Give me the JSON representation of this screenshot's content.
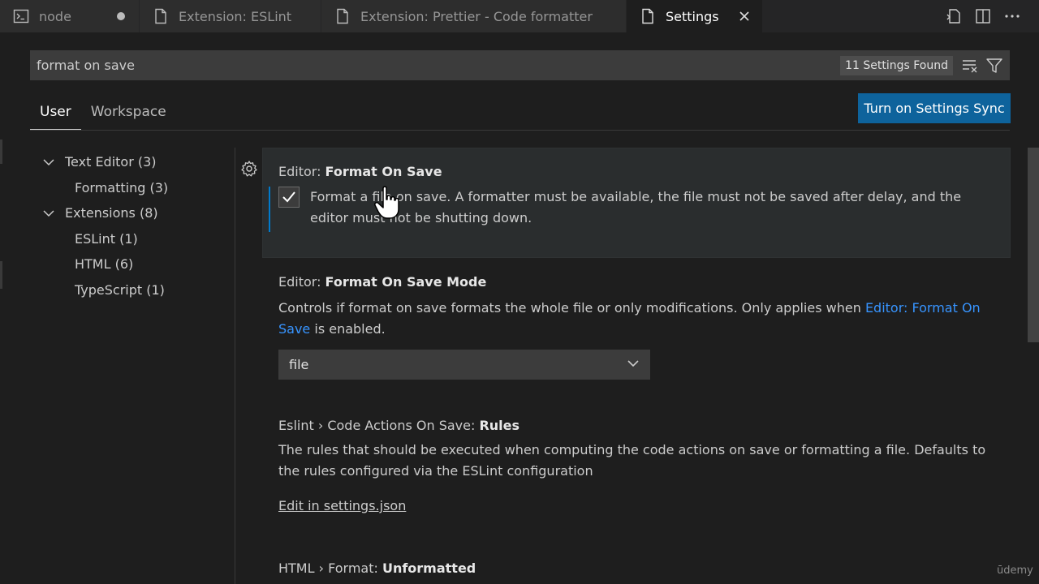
{
  "tabs": [
    {
      "label": "node",
      "icon": "terminal-icon",
      "indicator": "dirty-dot"
    },
    {
      "label": "Extension: ESLint",
      "icon": "file-icon"
    },
    {
      "label": "Extension: Prettier - Code formatter",
      "icon": "file-icon"
    },
    {
      "label": "Settings",
      "icon": "file-icon",
      "active": true,
      "indicator": "close-icon"
    }
  ],
  "tab_actions": [
    "open-settings-json-icon",
    "split-editor-icon",
    "more-actions-icon"
  ],
  "search": {
    "value": "format on save",
    "found_label": "11 Settings Found"
  },
  "scope_tabs": {
    "user": "User",
    "workspace": "Workspace"
  },
  "sync_button": "Turn on Settings Sync",
  "toc": [
    {
      "label": "Text Editor (3)",
      "expanded": true
    },
    {
      "label": "Formatting (3)"
    },
    {
      "label": "Extensions (8)",
      "expanded": true
    },
    {
      "label": "ESLint (1)"
    },
    {
      "label": "HTML (6)"
    },
    {
      "label": "TypeScript (1)"
    }
  ],
  "settings": {
    "format_on_save": {
      "category": "Editor: ",
      "name": "Format On Save",
      "checked": true,
      "description": "Format a file on save. A formatter must be available, the file must not be saved after delay, and the editor must not be shutting down."
    },
    "format_on_save_mode": {
      "category": "Editor: ",
      "name": "Format On Save Mode",
      "description_before": "Controls if format on save formats the whole file or only modifications. Only applies when ",
      "description_link": "Editor: Format On Save",
      "description_after": " is enabled.",
      "value": "file"
    },
    "eslint_rules": {
      "category": "Eslint › Code Actions On Save: ",
      "name": "Rules",
      "description": "The rules that should be executed when computing the code actions on save or formatting a file. Defaults to the rules configured via the ESLint configuration",
      "edit_link": "Edit in settings.json"
    },
    "html_unformatted": {
      "category": "HTML › Format: ",
      "name": "Unformatted"
    }
  },
  "watermark": "ūdemy",
  "colors": {
    "accent": "#0e639c",
    "focus": "#007acc",
    "link": "#3794ff"
  }
}
